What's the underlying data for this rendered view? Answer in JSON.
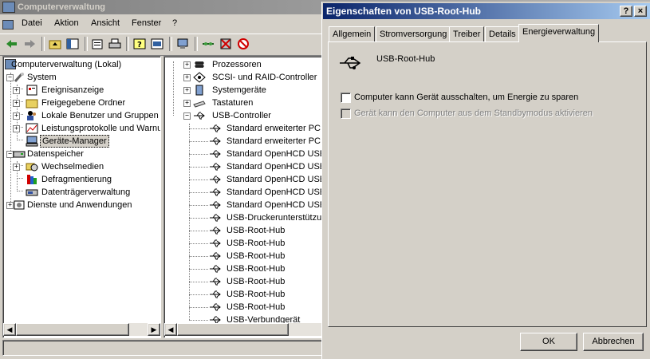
{
  "main": {
    "title": "Computerverwaltung",
    "menu": [
      "Datei",
      "Aktion",
      "Ansicht",
      "Fenster",
      "?"
    ]
  },
  "left_tree": [
    {
      "label": "Computerverwaltung (Lokal)",
      "icon": "computer-management-icon"
    },
    {
      "label": "System",
      "icon": "tools-icon"
    },
    {
      "label": "Ereignisanzeige",
      "icon": "event-viewer-icon"
    },
    {
      "label": "Freigegebene Ordner",
      "icon": "shared-folder-icon"
    },
    {
      "label": "Lokale Benutzer und Gruppen",
      "icon": "users-icon"
    },
    {
      "label": "Leistungsprotokolle und Warnu",
      "icon": "performance-icon"
    },
    {
      "label": "Geräte-Manager",
      "icon": "device-manager-icon",
      "selected": true
    },
    {
      "label": "Datenspeicher",
      "icon": "storage-icon"
    },
    {
      "label": "Wechselmedien",
      "icon": "removable-media-icon"
    },
    {
      "label": "Defragmentierung",
      "icon": "defrag-icon"
    },
    {
      "label": "Datenträgerverwaltung",
      "icon": "disk-management-icon"
    },
    {
      "label": "Dienste und Anwendungen",
      "icon": "services-icon"
    }
  ],
  "right_tree": {
    "categories": [
      "Prozessoren",
      "SCSI- und RAID-Controller",
      "Systemgeräte",
      "Tastaturen",
      "USB-Controller"
    ],
    "usb_devices": [
      "Standard erweiterter PCI-",
      "Standard erweiterter PCI-",
      "Standard OpenHCD USE",
      "Standard OpenHCD USE",
      "Standard OpenHCD USE",
      "Standard OpenHCD USE",
      "Standard OpenHCD USE",
      "USB-Druckerunterstützur",
      "USB-Root-Hub",
      "USB-Root-Hub",
      "USB-Root-Hub",
      "USB-Root-Hub",
      "USB-Root-Hub",
      "USB-Root-Hub",
      "USB-Root-Hub",
      "USB-Verbundgerät"
    ]
  },
  "dialog": {
    "title": "Eigenschaften von USB-Root-Hub",
    "help_btn": "?",
    "close_btn": "×",
    "tabs": [
      "Allgemein",
      "Stromversorgung",
      "Treiber",
      "Details",
      "Energieverwaltung"
    ],
    "active_tab": "Energieverwaltung",
    "device_name": "USB-Root-Hub",
    "checkbox1": "Computer kann Gerät ausschalten, um Energie zu sparen",
    "checkbox2": "Gerät kann den Computer aus dem Standbymodus aktivieren",
    "ok": "OK",
    "cancel": "Abbrechen"
  }
}
